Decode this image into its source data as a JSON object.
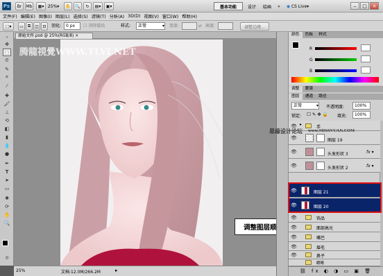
{
  "app": {
    "logo": "Ps",
    "zoom": "25%",
    "workspace": "基本功能",
    "design": "设计",
    "painting": "绘画",
    "more": "»",
    "cslive": "CS Live"
  },
  "menu": [
    "文件(F)",
    "编辑(E)",
    "图像(I)",
    "图层(L)",
    "选择(S)",
    "滤镜(T)",
    "分析(A)",
    "3D(D)",
    "视图(V)",
    "窗口(W)",
    "帮助(H)"
  ],
  "options": {
    "feather_label": "羽化:",
    "feather_value": "0 px",
    "antialias": "消除锯齿",
    "style_label": "样式:",
    "style_value": "正常",
    "width_label": "宽度:",
    "height_label": "高度:",
    "refine": "调整边缘..."
  },
  "document": {
    "tab": "原始文件.psd @ 25%(RGB/8)",
    "close": "×"
  },
  "status": {
    "zoom": "25%",
    "doc": "文档:12.0M/266.2M"
  },
  "watermarks": {
    "top": "腾龍視覺WWW.TLVI.NET",
    "right": "思缘设计论坛",
    "right2": "www.MISSVUAN.COM"
  },
  "panels": {
    "color_tabs": [
      "颜色",
      "色板",
      "样式"
    ],
    "adjust_tabs": [
      "调整",
      "蒙版"
    ],
    "layer_tabs": [
      "图层",
      "通道",
      "路径"
    ],
    "color_sliders": [
      "R",
      "G",
      "B"
    ],
    "blend_mode": "正常",
    "opacity_label": "不透明度:",
    "opacity_value": "100%",
    "lock_label": "锁定:",
    "fill_label": "填充:",
    "fill_value": "100%"
  },
  "layers": [
    {
      "name": "手",
      "type": "folder"
    },
    {
      "name": "图层 19",
      "type": "layer"
    },
    {
      "name": "头发形状 3",
      "type": "shape"
    },
    {
      "name": "头发形状 2",
      "type": "shape"
    },
    {
      "name": "图层 21",
      "type": "layer",
      "selected": true
    },
    {
      "name": "图层 20",
      "type": "layer",
      "selected": true
    },
    {
      "name": "饰品",
      "type": "folder"
    },
    {
      "name": "面部高光",
      "type": "folder"
    },
    {
      "name": "嘴巴",
      "type": "folder"
    },
    {
      "name": "眉毛",
      "type": "folder"
    },
    {
      "name": "鼻子",
      "type": "folder"
    },
    {
      "name": "眼睛",
      "type": "folder"
    }
  ],
  "callout": "调整图层顺序",
  "colors": {
    "selected": "#0a246a",
    "highlight": "#e01010"
  }
}
